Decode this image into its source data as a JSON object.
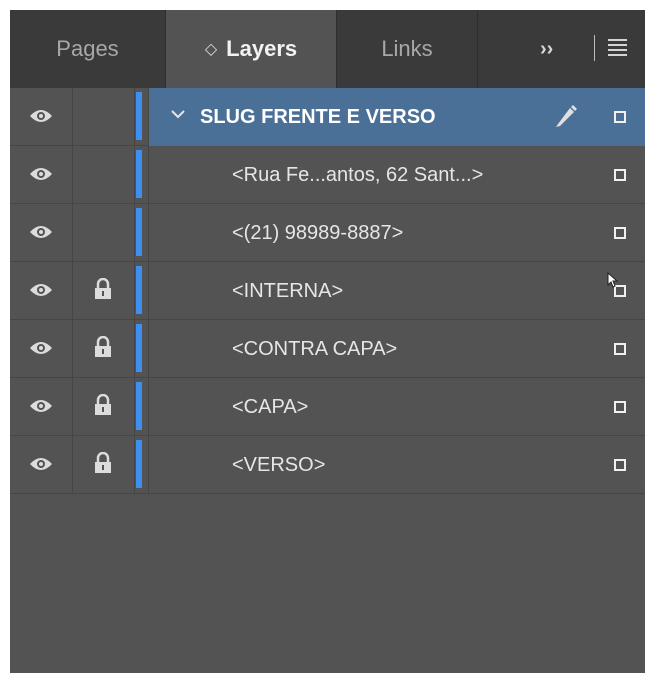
{
  "tabs": [
    {
      "label": "Pages",
      "active": false
    },
    {
      "label": "Layers",
      "active": true
    },
    {
      "label": "Links",
      "active": false
    }
  ],
  "tab_overflow": "››",
  "layers": [
    {
      "name": "SLUG FRENTE E VERSO",
      "level": 0,
      "visible": true,
      "locked": false,
      "expanded": true,
      "selected": true
    },
    {
      "name": "<Rua Fe...antos, 62 Sant...>",
      "level": 1,
      "visible": true,
      "locked": false
    },
    {
      "name": "<(21) 98989-8887>",
      "level": 1,
      "visible": true,
      "locked": false
    },
    {
      "name": "<INTERNA>",
      "level": 1,
      "visible": true,
      "locked": true
    },
    {
      "name": "<CONTRA CAPA>",
      "level": 1,
      "visible": true,
      "locked": true
    },
    {
      "name": "<CAPA>",
      "level": 1,
      "visible": true,
      "locked": true
    },
    {
      "name": "<VERSO>",
      "level": 1,
      "visible": true,
      "locked": true
    }
  ],
  "colors": {
    "panel_bg": "#535353",
    "tabbar_bg": "#3a3a3a",
    "selection": "#4b7097",
    "layer_color": "#3d8ff0"
  }
}
